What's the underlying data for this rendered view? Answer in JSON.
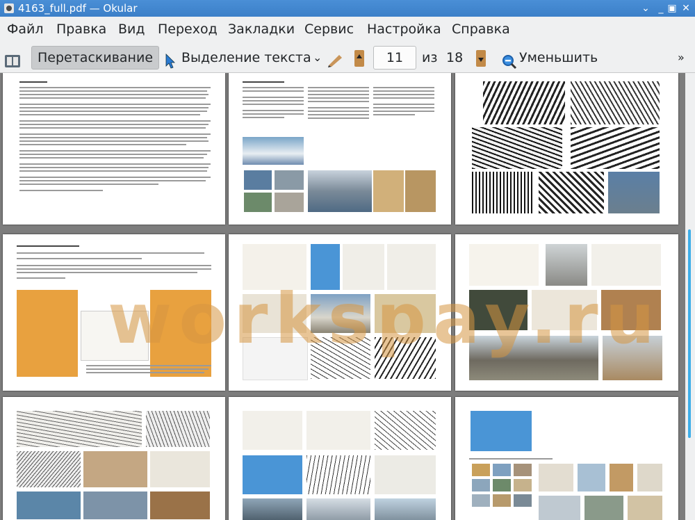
{
  "window": {
    "title": "4163_full.pdf — Okular",
    "minimize": "_",
    "maximize": "▣",
    "close": "✕"
  },
  "menu": [
    "Файл",
    "Правка",
    "Вид",
    "Переход",
    "Закладки",
    "Сервис",
    "Настройка",
    "Справка"
  ],
  "toolbar": {
    "browse_label": "Перетаскивание",
    "text_select_label": "Выделение текста",
    "page_current": "11",
    "page_of": "из",
    "page_total": "18",
    "zoom_out_label": "Уменьшить",
    "overflow": "»"
  },
  "watermark": "workspay.ru",
  "colors": {
    "accent": "#3daee9",
    "titlebar": "#4a8fd6",
    "orange": "#e8a13f",
    "blue": "#4a95d6"
  }
}
